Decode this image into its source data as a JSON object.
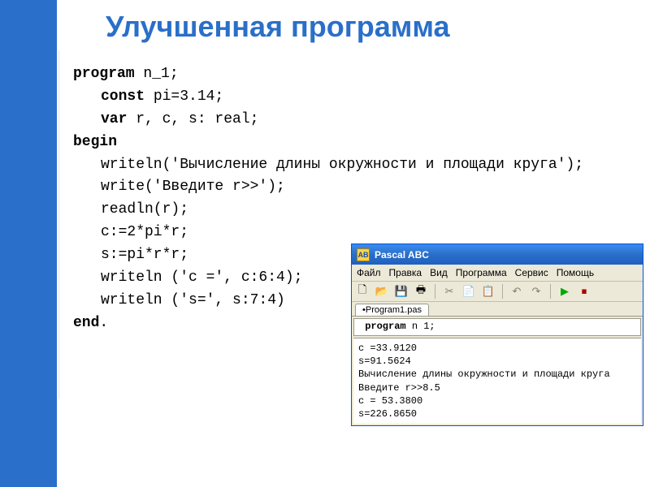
{
  "title": "Улучшенная программа",
  "code": {
    "l1_kw": "program",
    "l1_rest": " n_1;",
    "l2_kw": "const",
    "l2_rest": " pi=3.14;",
    "l3_kw": "var",
    "l3_rest": " r, c, s: real;",
    "l4_kw": "begin",
    "l5": "writeln('Вычисление длины окружности и площади круга');",
    "l6": "write('Введите r>>');",
    "l7": "readln(r);",
    "l8": "c:=2*pi*r;",
    "l9": "s:=pi*r*r;",
    "l10": "writeln ('c =', c:6:4);",
    "l11": "writeln ('s=', s:7:4)",
    "l12_kw": "end",
    "l12_rest": "."
  },
  "pascal_window": {
    "title_text": "Pascal ABC",
    "icon_text": "AB",
    "menu": {
      "file": "Файл",
      "edit": "Правка",
      "view": "Вид",
      "program": "Программа",
      "service": "Сервис",
      "help": "Помощь"
    },
    "toolbar_icons": {
      "new": "🗋",
      "open": "📂",
      "save": "💾",
      "print": "🖶",
      "cut": "✂",
      "copy": "📄",
      "paste": "📋",
      "undo": "↶",
      "redo": "↷",
      "run": "▶",
      "stop": "⏹"
    },
    "tab_label": "•Program1.pas",
    "editor_kw": "program",
    "editor_rest": " n 1;",
    "output": {
      "o1": "c =33.9120",
      "o2": "s=91.5624",
      "o3": "Вычисление длины окружности и площади круга",
      "o4": "Введите r>>8.5",
      "o5": "c = 53.3800",
      "o6": "s=226.8650"
    }
  }
}
